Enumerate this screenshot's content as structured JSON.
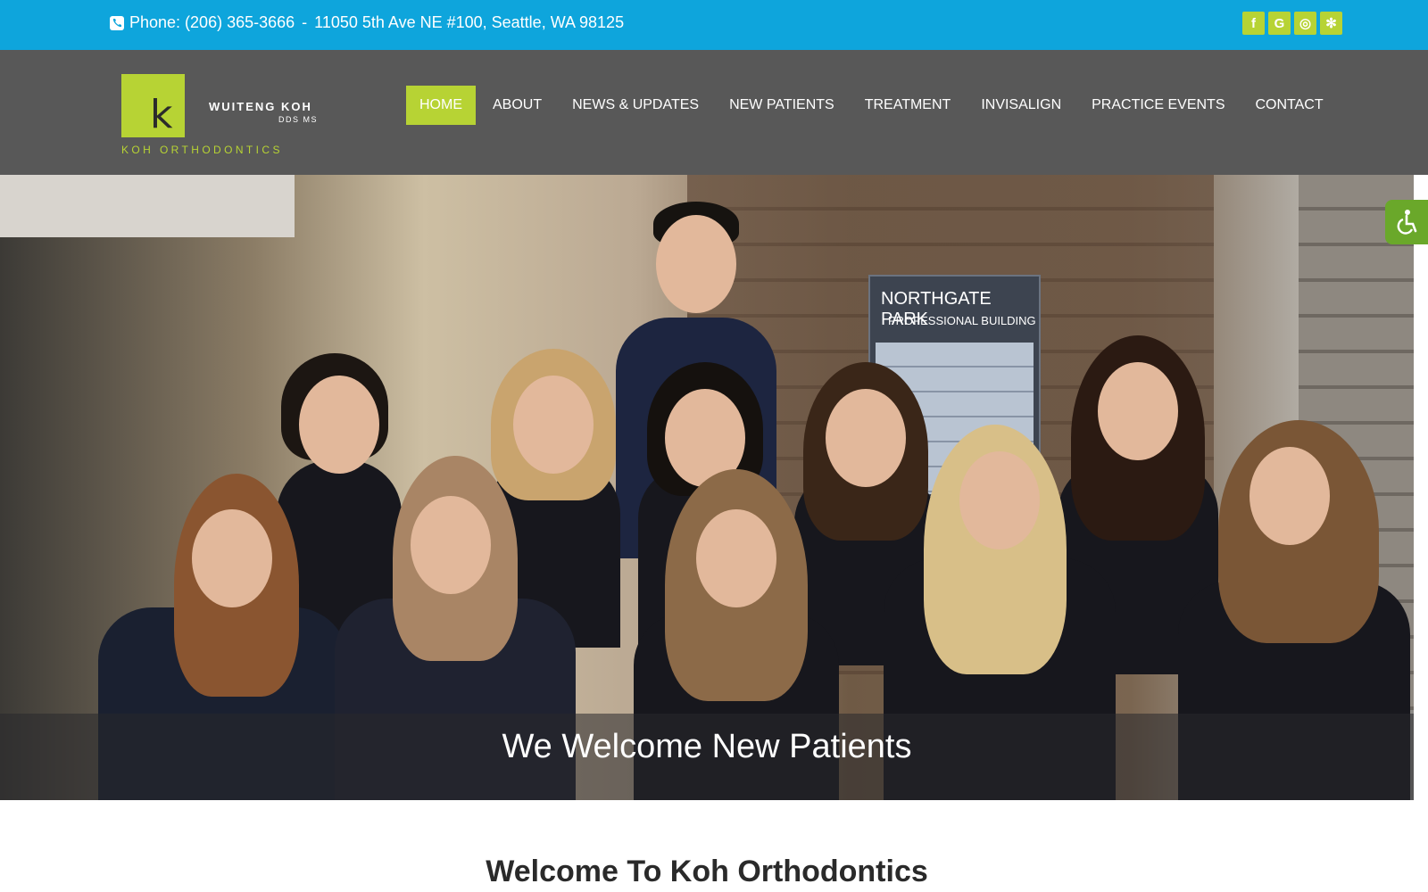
{
  "topbar": {
    "phone_text": "Phone: (206) 365-3666",
    "separator": "-",
    "address": "11050 5th Ave NE #100, Seattle, WA 98125",
    "social": [
      {
        "icon": "facebook-icon",
        "glyph": "f"
      },
      {
        "icon": "google-icon",
        "glyph": "G"
      },
      {
        "icon": "instagram-icon",
        "glyph": "◎"
      },
      {
        "icon": "yelp-icon",
        "glyph": "✻"
      }
    ]
  },
  "logo": {
    "mark_letter": "k",
    "doctor_name": "WUITENG KOH",
    "credentials": "DDS MS",
    "brand": "KOH ORTHODONTICS"
  },
  "nav": {
    "items": [
      {
        "label": "HOME",
        "active": true
      },
      {
        "label": "ABOUT",
        "active": false
      },
      {
        "label": "NEWS & UPDATES",
        "active": false
      },
      {
        "label": "NEW PATIENTS",
        "active": false
      },
      {
        "label": "TREATMENT",
        "active": false
      },
      {
        "label": "INVISALIGN",
        "active": false
      },
      {
        "label": "PRACTICE EVENTS",
        "active": false
      },
      {
        "label": "CONTACT",
        "active": false
      }
    ]
  },
  "hero": {
    "sign_title": "NORTHGATE PARK",
    "sign_subtitle": "PROFESSIONAL BUILDING",
    "caption": "We Welcome New Patients"
  },
  "accessibility": {
    "icon": "accessibility-icon"
  },
  "main": {
    "heading": "Welcome To Koh Orthodontics"
  },
  "colors": {
    "topbar": "#0ea5dc",
    "header": "#585858",
    "accent": "#b7d334",
    "a11y": "#6aa82a"
  }
}
